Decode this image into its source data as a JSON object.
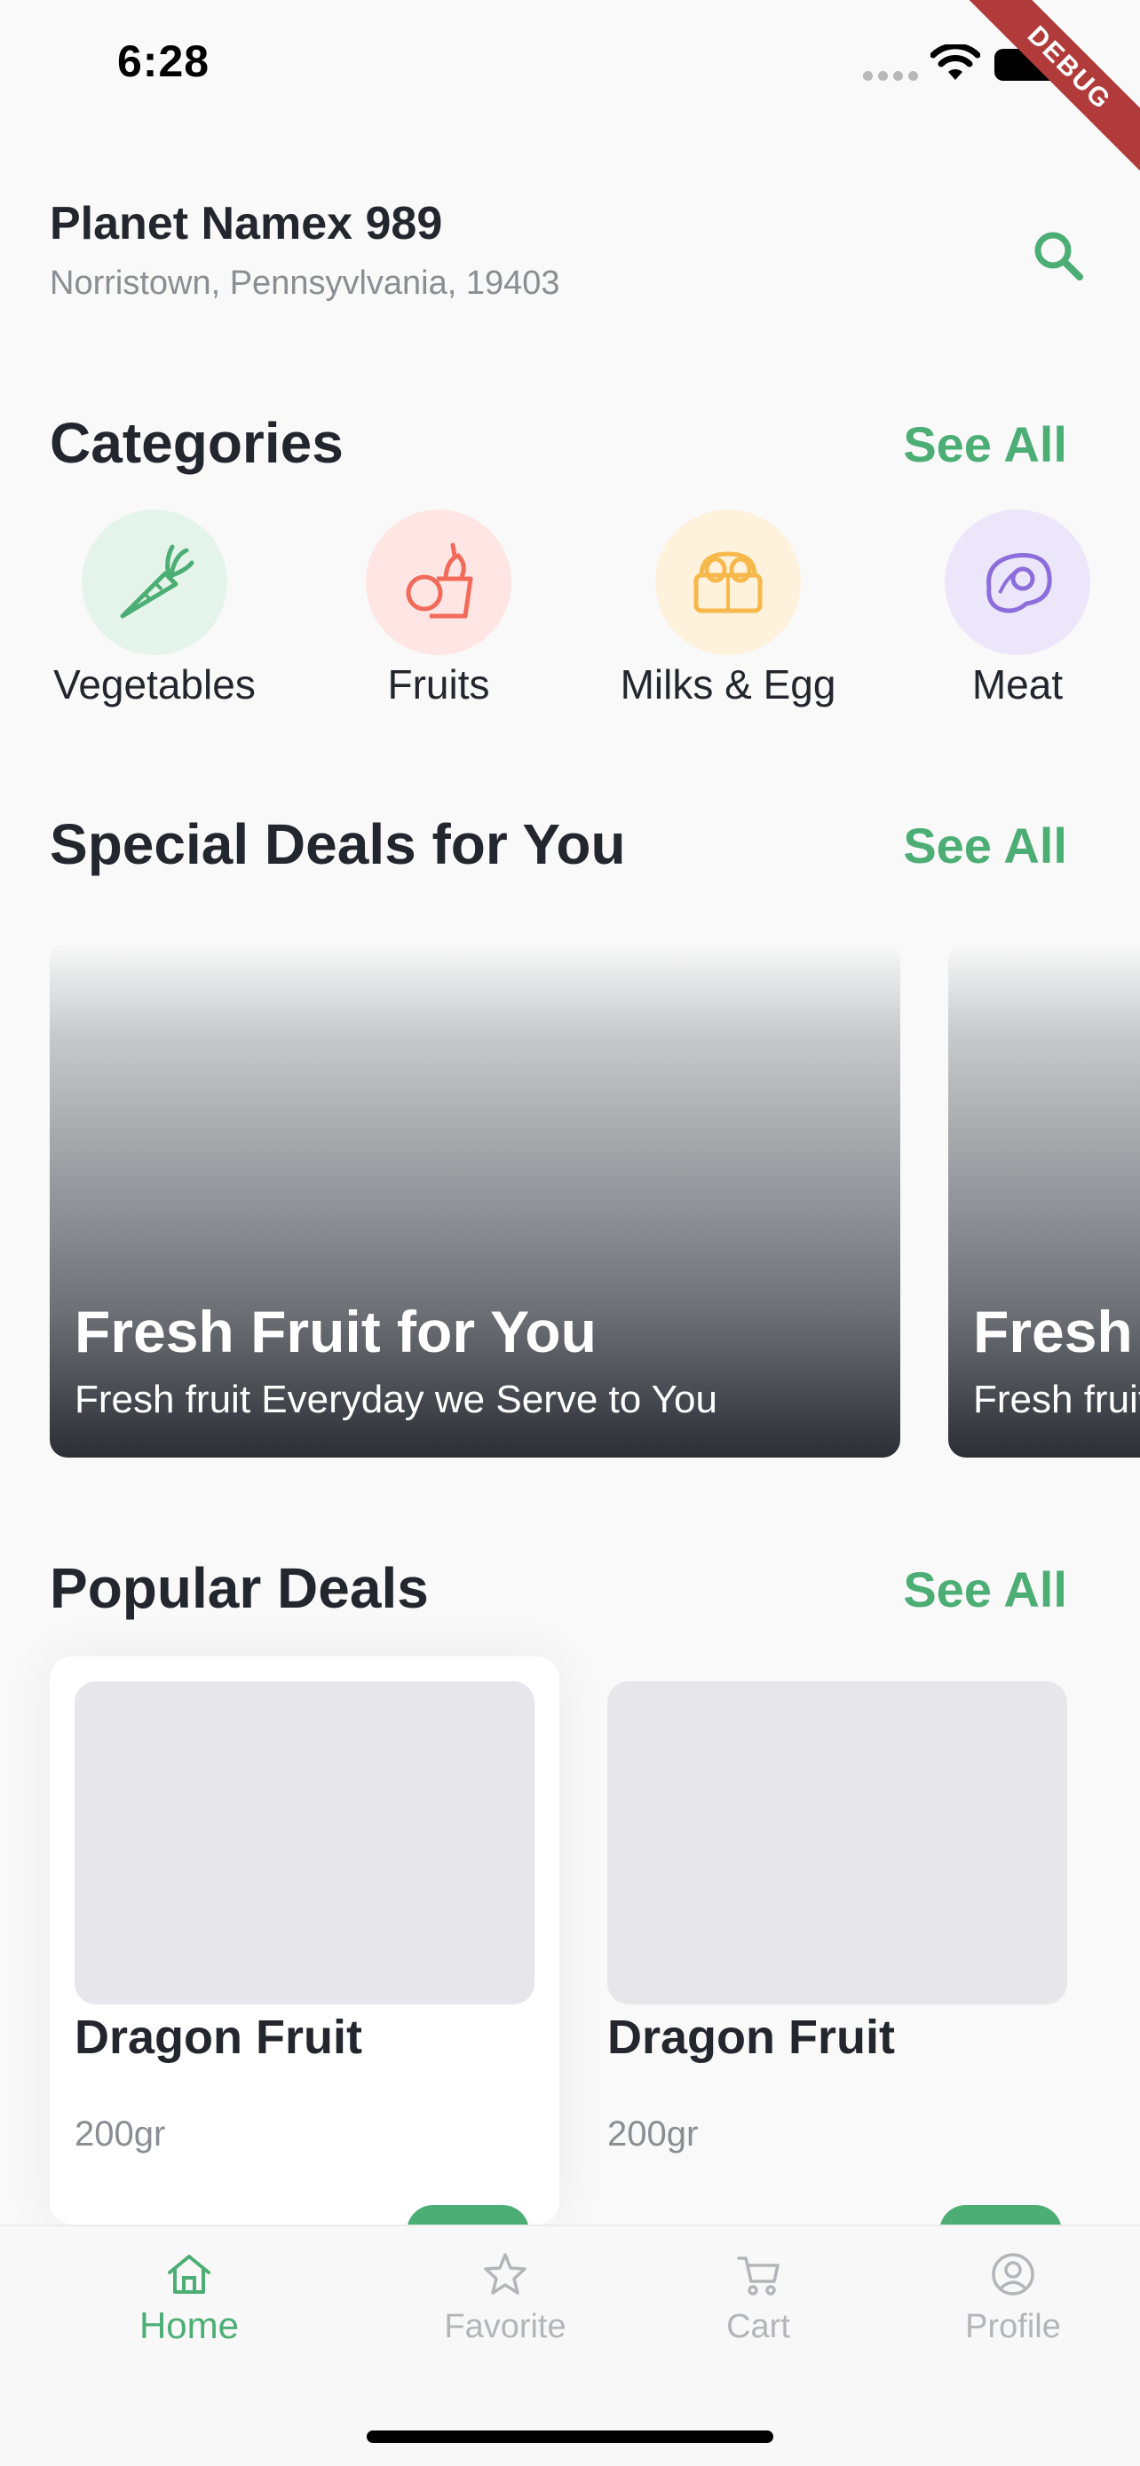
{
  "status_bar": {
    "time": "6:28"
  },
  "debug_label": "DEBUG",
  "header": {
    "store_name": "Planet Namex 989",
    "address": "Norristown, Pennsyvlvania, 19403",
    "search_icon": "search-icon"
  },
  "categories": {
    "title": "Categories",
    "see_all": "See All",
    "items": [
      {
        "label": "Vegetables",
        "icon": "carrot-icon",
        "bg": "#e5f4ea",
        "color": "#4cae74"
      },
      {
        "label": "Fruits",
        "icon": "fruit-basket-icon",
        "bg": "#ffe5e3",
        "color": "#f26a5a"
      },
      {
        "label": "Milks & Egg",
        "icon": "egg-carton-icon",
        "bg": "#fff2dc",
        "color": "#f7b84b"
      },
      {
        "label": "Meat",
        "icon": "steak-icon",
        "bg": "#ece6fb",
        "color": "#8c6ddc"
      }
    ]
  },
  "special_deals": {
    "title": "Special Deals for You",
    "see_all": "See All",
    "items": [
      {
        "title": "Fresh Fruit for You",
        "subtitle": "Fresh fruit Everyday we Serve to You"
      },
      {
        "title": "Fresh Fruit for You",
        "subtitle": "Fresh fruit Everyday we Serve to You"
      }
    ]
  },
  "popular_deals": {
    "title": "Popular Deals",
    "see_all": "See All",
    "items": [
      {
        "name": "Dragon Fruit",
        "weight": "200gr"
      },
      {
        "name": "Dragon Fruit",
        "weight": "200gr"
      }
    ]
  },
  "bottom_nav": {
    "items": [
      {
        "label": "Home",
        "icon": "home-icon",
        "active": true
      },
      {
        "label": "Favorite",
        "icon": "star-icon",
        "active": false
      },
      {
        "label": "Cart",
        "icon": "cart-icon",
        "active": false
      },
      {
        "label": "Profile",
        "icon": "profile-icon",
        "active": false
      }
    ]
  },
  "colors": {
    "accent": "#4cae74",
    "text": "#23272d",
    "muted": "#8a8d92"
  }
}
